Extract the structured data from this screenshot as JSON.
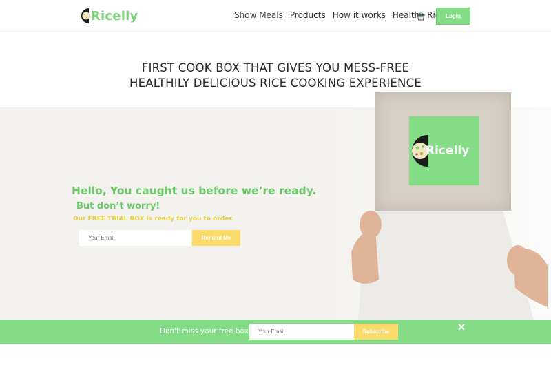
{
  "header": {
    "logo_text": "Ricelly",
    "nav": [
      "Show Meals",
      "Products",
      "How it works",
      "Healthy Rice"
    ],
    "cart_icon": "basket-icon",
    "login_label": "Login"
  },
  "headline": {
    "line1": "FIRST COOK BOX THAT GIVES YOU MESS-FREE",
    "line2": "HEALTHILY DELICIOUS RICE COOKING EXPERIENCE"
  },
  "hero": {
    "title": "Hello, You caught us before we’re ready.",
    "subtitle": "But don’t worry!",
    "trial_text": "Our FREE TRIAL BOX is ready for you to order.",
    "email_placeholder": "Your Email",
    "remind_label": "Remind Me",
    "box_logo_text": "Ricelly"
  },
  "subscribe_bar": {
    "text": "Don't miss your free box!",
    "email_placeholder": "Your Email",
    "button_label": "Subscribe",
    "close_icon": "close-icon"
  },
  "colors": {
    "brand_green": "#84dc86",
    "title_green": "#6cc96a",
    "accent_yellow": "#fbdc6a",
    "trial_yellow": "#e8cf3d"
  }
}
